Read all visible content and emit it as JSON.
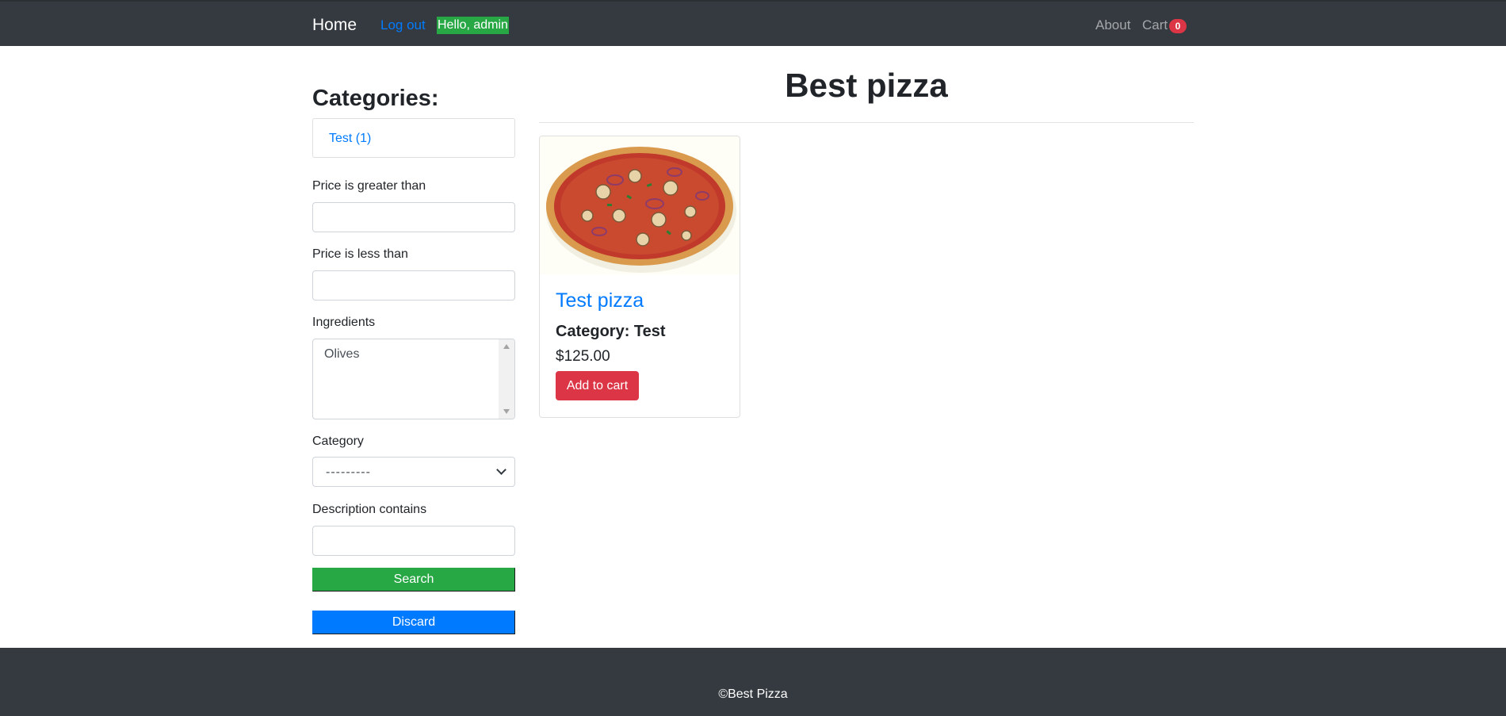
{
  "navbar": {
    "home": "Home",
    "logout": "Log out",
    "greeting": "Hello, admin",
    "about": "About",
    "cart": "Cart",
    "cart_count": "0"
  },
  "sidebar": {
    "categories_heading": "Categories:",
    "categories": [
      {
        "label": "Test (1)"
      }
    ],
    "filters": {
      "price_gt_label": "Price is greater than",
      "price_gt_value": "",
      "price_lt_label": "Price is less than",
      "price_lt_value": "",
      "ingredients_label": "Ingredients",
      "ingredients_options": [
        "Olives"
      ],
      "category_label": "Category",
      "category_selected": "---------",
      "description_label": "Description contains",
      "description_value": ""
    },
    "search_button": "Search",
    "discard_button": "Discard"
  },
  "main": {
    "title": "Best pizza",
    "products": [
      {
        "name": "Test pizza",
        "category_text": "Category: Test",
        "price": "$125.00",
        "add_button": "Add to cart",
        "image_icon": "pizza-image"
      }
    ]
  },
  "footer": {
    "text": "©Best Pizza"
  },
  "colors": {
    "navbar_bg": "#343a40",
    "link": "#007bff",
    "success": "#28a745",
    "danger": "#dc3545"
  }
}
